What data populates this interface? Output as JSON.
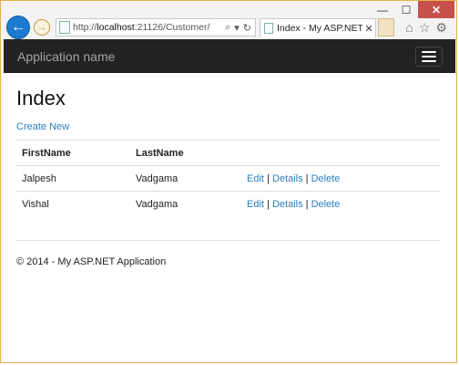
{
  "browser": {
    "url_prefix": "http://",
    "url_host": "localhost",
    "url_path": ":21126/Customer/",
    "tab_title": "Index - My ASP.NET A...",
    "tab_close": "✕",
    "icons": [
      "search-icon",
      "dropdown-icon",
      "refresh-icon",
      "home-icon",
      "favorites-star-icon",
      "settings-gear-icon"
    ]
  },
  "window": {
    "minimize": "—",
    "maximize": "☐",
    "close": "✕"
  },
  "navbar": {
    "brand": "Application name"
  },
  "page": {
    "title": "Index",
    "create_link": "Create New",
    "columns": [
      "FirstName",
      "LastName"
    ],
    "rows": [
      {
        "first": "Jalpesh",
        "last": "Vadgama",
        "edit": "Edit",
        "details": "Details",
        "delete": "Delete"
      },
      {
        "first": "Vishal",
        "last": "Vadgama",
        "edit": "Edit",
        "details": "Details",
        "delete": "Delete"
      }
    ],
    "action_separator": "|"
  },
  "footer": {
    "text": "© 2014 - My ASP.NET Application"
  },
  "colors": {
    "navbar": "#222222",
    "link": "#2a7fc1",
    "window_border": "#e3b34a",
    "close_button": "#c7504b"
  }
}
